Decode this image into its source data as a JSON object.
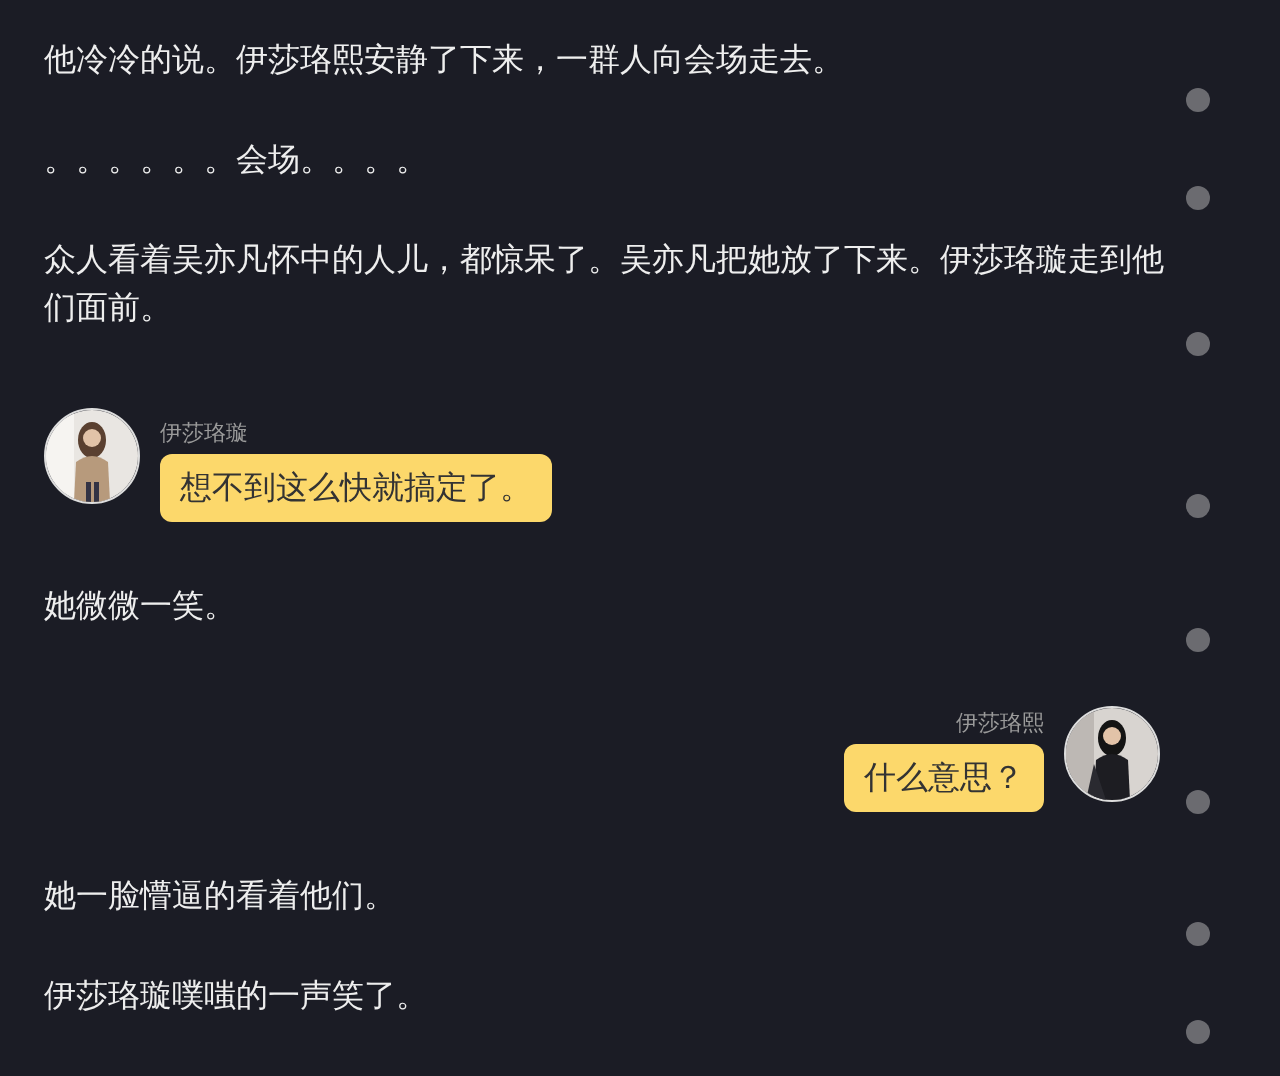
{
  "items": [
    {
      "kind": "text",
      "text": "他冷冷的说。伊莎珞熙安静了下来，一群人向会场走去。"
    },
    {
      "kind": "text",
      "text": "。。。。。。会场。。。。"
    },
    {
      "kind": "text",
      "text": "众人看着吴亦凡怀中的人儿，都惊呆了。吴亦凡把她放了下来。伊莎珞璇走到他们面前。"
    },
    {
      "kind": "left_msg",
      "sender": "伊莎珞璇",
      "text": "想不到这么快就搞定了。"
    },
    {
      "kind": "text",
      "text": "她微微一笑。"
    },
    {
      "kind": "right_msg",
      "sender": "伊莎珞熙",
      "text": "什么意思？"
    },
    {
      "kind": "text",
      "text": "她一脸懵逼的看着他们。"
    },
    {
      "kind": "text",
      "text": "伊莎珞璇噗嗤的一声笑了。"
    }
  ]
}
